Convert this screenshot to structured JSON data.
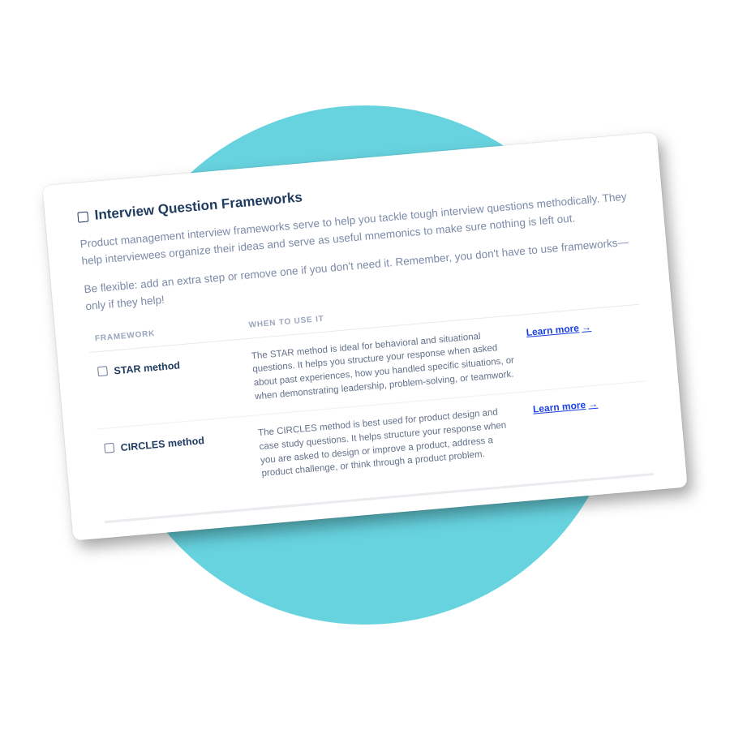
{
  "heading": "Interview Question Frameworks",
  "intro_p1": "Product management interview frameworks serve to help you tackle tough interview questions methodically. They help interviewees organize their ideas and serve as useful mnemonics to make sure nothing is left out.",
  "intro_p2": "Be flexible: add an extra step or remove one if you don't need it. Remember, you don't have to use frameworks—only if they help!",
  "table": {
    "col_framework": "FRAMEWORK",
    "col_when": "WHEN TO USE IT",
    "rows": [
      {
        "name": "STAR method",
        "desc": "The STAR method is ideal for behavioral and situational questions. It helps you structure your response when asked about past experiences, how you handled specific situations, or when demonstrating leadership, problem-solving, or teamwork.",
        "link": "Learn more"
      },
      {
        "name": "CIRCLES method",
        "desc": "The CIRCLES method is best used for product design and case study questions. It helps structure your response when you are asked to design or improve a product, address a product challenge, or think through a product problem.",
        "link": "Learn more"
      }
    ]
  }
}
